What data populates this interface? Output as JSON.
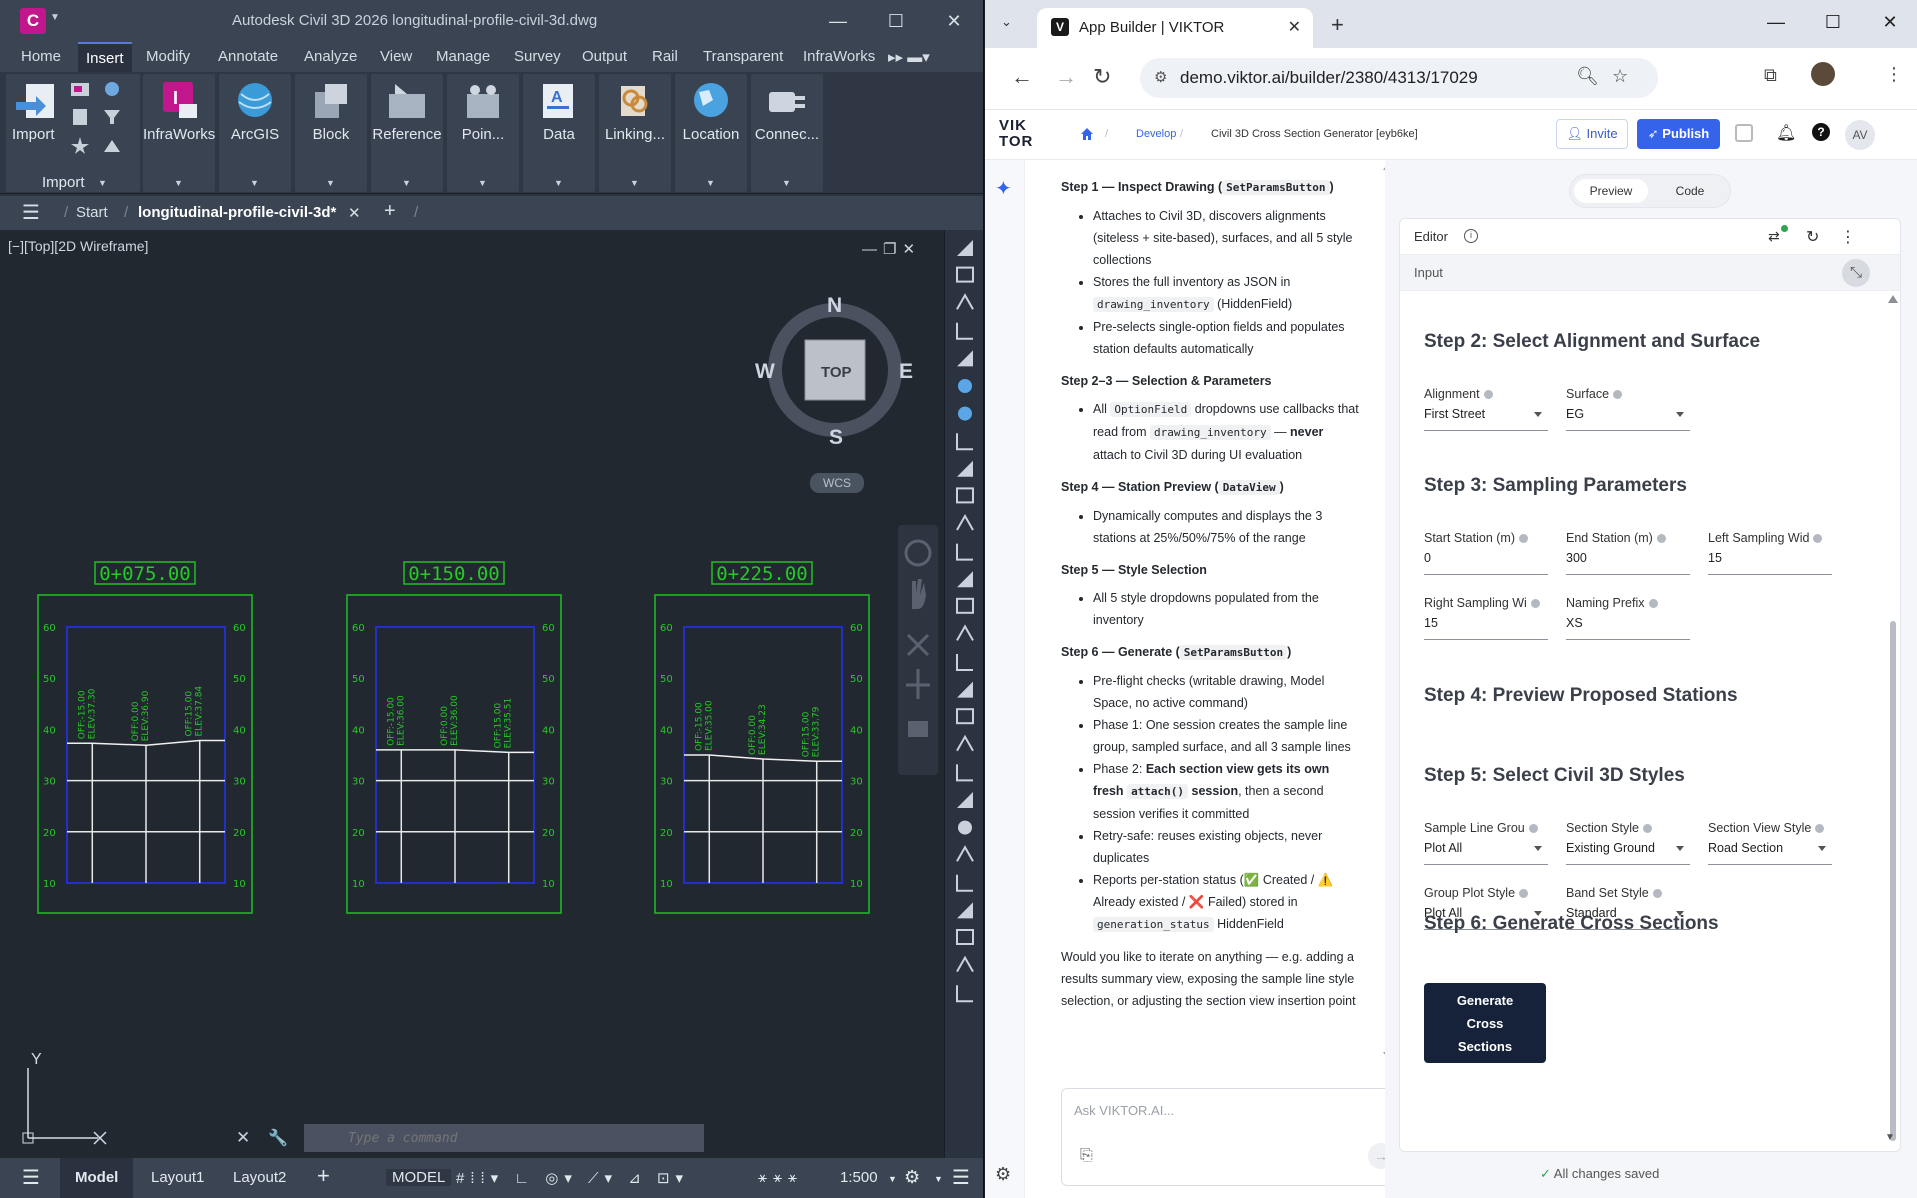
{
  "cad": {
    "title": "Autodesk Civil 3D 2026   longitudinal-profile-civil-3d.dwg",
    "logo_letter": "C",
    "menus": [
      "Home",
      "Insert",
      "Modify",
      "Annotate",
      "Analyze",
      "View",
      "Manage",
      "Survey",
      "Output",
      "Rail",
      "Transparent",
      "InfraWorks"
    ],
    "active_menu": "Insert",
    "ribbon": [
      {
        "label": "Import",
        "color": "#4a8fd8"
      },
      {
        "label": "InfraWorks",
        "color": "#c2168d"
      },
      {
        "label": "ArcGIS",
        "color": "#3b9ad8"
      },
      {
        "label": "Block",
        "color": "#9aa6b6"
      },
      {
        "label": "Reference",
        "color": "#a8b3c2"
      },
      {
        "label": "Poin...",
        "color": "#a8b3c2"
      },
      {
        "label": "Data",
        "color": "#e9eef4"
      },
      {
        "label": "Linking...",
        "color": "#d0a050"
      },
      {
        "label": "Location",
        "color": "#4aa3e0"
      },
      {
        "label": "Connec...",
        "color": "#cfd5de"
      }
    ],
    "import_group_label": "Import",
    "tabs": {
      "start": "Start",
      "doc": "longitudinal-profile-civil-3d*"
    },
    "viewport_label": "[−][Top][2D Wireframe]",
    "compass": {
      "n": "N",
      "s": "S",
      "e": "E",
      "w": "W",
      "top": "TOP"
    },
    "wcs": "WCS",
    "sections": [
      {
        "station": "0+075.00",
        "left": "OFF:-15.00\nELEV:37.30",
        "center": "OFF:0.00\nELEV:36.90",
        "right": "OFF:15.00\nELEV:37.84"
      },
      {
        "station": "0+150.00",
        "left": "OFF:-15.00\nELEV:36.00",
        "center": "OFF:0.00\nELEV:36.00",
        "right": "OFF:15.00\nELEV:35.51"
      },
      {
        "station": "0+225.00",
        "left": "OFF:-15.00\nELEV:35.00",
        "center": "OFF:0.00\nELEV:34.23",
        "right": "OFF:15.00\nELEV:33.79"
      }
    ],
    "section_ticks": [
      "60",
      "50",
      "40",
      "30",
      "20",
      "10"
    ],
    "ucs": {
      "y": "Y"
    },
    "command_placeholder": "Type a command",
    "status": {
      "model": "Model",
      "layout1": "Layout1",
      "layout2": "Layout2",
      "model_space": "MODEL",
      "scale": "1:500"
    }
  },
  "browser": {
    "tab_title": "App Builder | VIKTOR",
    "favicon_letter": "V",
    "url": "demo.viktor.ai/builder/2380/4313/17029"
  },
  "viktor": {
    "logo_line1": "VIK",
    "logo_line2": "TOR",
    "crumb_develop": "Develop",
    "crumb_app": "Civil 3D Cross Section Generator [eyb6ke]",
    "invite": "Invite",
    "publish": "Publish",
    "avatar": "AV",
    "chat": {
      "step1_title": "Step 1 — Inspect Drawing",
      "step1_code": "SetParamsButton",
      "step1_items": [
        "Attaches to Civil 3D, discovers alignments (siteless + site-based), surfaces, and all 5 style collections",
        "Pre-selects single-option fields and populates station defaults automatically"
      ],
      "step1_store_pre": "Stores the full inventory as JSON in",
      "step1_store_code": "drawing_inventory",
      "step1_store_post": "(HiddenField)",
      "step23_title": "Step 2–3 — Selection & Parameters",
      "step23_all": "All",
      "step23_code1": "OptionField",
      "step23_mid": "dropdowns use callbacks that read from",
      "step23_code2": "drawing_inventory",
      "step23_dash": "—",
      "step23_never": "never",
      "step23_end": "attach to Civil 3D during UI evaluation",
      "step4_title": "Step 4 — Station Preview",
      "step4_code": "DataView",
      "step4_item": "Dynamically computes and displays the 3 stations at 25%/50%/75% of the range",
      "step5_title": "Step 5 — Style Selection",
      "step5_item": "All 5 style dropdowns populated from the inventory",
      "step6_title": "Step 6 — Generate",
      "step6_code": "SetParamsButton",
      "step6_item1": "Pre-flight checks (writable drawing, Model Space, no active command)",
      "step6_item2": "Phase 1: One session creates the sample line group, sampled surface, and all 3 sample lines",
      "step6_p2_pre": "Phase 2:",
      "step6_p2_bold": "Each section view gets its own fresh",
      "step6_p2_code": "attach()",
      "step6_p2_bold2": "session",
      "step6_p2_post": ", then a second session verifies it committed",
      "step6_item4": "Retry-safe: reuses existing objects, never duplicates",
      "step6_rep_pre": "Reports per-station status (",
      "step6_rep_created": "Created /",
      "step6_rep_exists": "Already existed /",
      "step6_rep_failed": "Failed) stored in",
      "step6_rep_code": "generation_status",
      "step6_rep_post": "HiddenField",
      "closing": "Would you like to iterate on anything — e.g. adding a results summary view, exposing the sample line style selection, or adjusting the section view insertion point",
      "input_placeholder": "Ask VIKTOR.AI..."
    },
    "seg_preview": "Preview",
    "seg_code": "Code",
    "editor_label": "Editor",
    "input_label": "Input",
    "step2_title": "Step 2: Select Alignment and Surface",
    "alignment_label": "Alignment",
    "alignment_value": "First Street",
    "surface_label": "Surface",
    "surface_value": "EG",
    "step3_title": "Step 3: Sampling Parameters",
    "start_label": "Start Station (m)",
    "start_value": "0",
    "end_label": "End Station (m)",
    "end_value": "300",
    "left_label": "Left Sampling Wid",
    "left_value": "15",
    "right_label": "Right Sampling Wi",
    "right_value": "15",
    "prefix_label": "Naming Prefix",
    "prefix_value": "XS",
    "step4_title": "Step 4: Preview Proposed Stations",
    "step5_title": "Step 5: Select Civil 3D Styles",
    "sl_group_label": "Sample Line Grou",
    "sl_group_value": "Plot All",
    "section_style_label": "Section Style",
    "section_style_value": "Existing Ground",
    "sv_style_label": "Section View Style",
    "sv_style_value": "Road Section",
    "group_plot_label": "Group Plot Style",
    "group_plot_value": "Plot All",
    "band_set_label": "Band Set Style",
    "band_set_value": "Standard",
    "step6_title": "Step 6: Generate Cross Sections",
    "gen_line1": "Generate",
    "gen_line2": "Cross",
    "gen_line3": "Sections",
    "saved": "All changes saved"
  }
}
